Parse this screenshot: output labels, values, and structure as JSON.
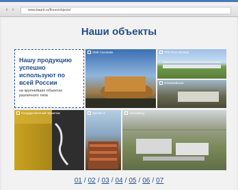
{
  "browser": {
    "url": "www.baurit.ru/floors/objects/"
  },
  "page": {
    "title": "Наши объекты",
    "intro_heading": "Нашу продукцию успешно используют по всей России",
    "intro_sub": "на крупнейших объектах различного типа"
  },
  "tiles": [
    {
      "label": "ХМК Сколково"
    },
    {
      "label": "ТРК Река Москва"
    },
    {
      "label": "Олимпийская"
    },
    {
      "label": "Государственный Эрмитаж"
    },
    {
      "label": "Лукойл-2"
    },
    {
      "label": "Автозавод"
    }
  ],
  "pager": [
    "01",
    "02",
    "03",
    "04",
    "05",
    "06",
    "07"
  ],
  "colors": {
    "accent": "#1f4e8c"
  }
}
